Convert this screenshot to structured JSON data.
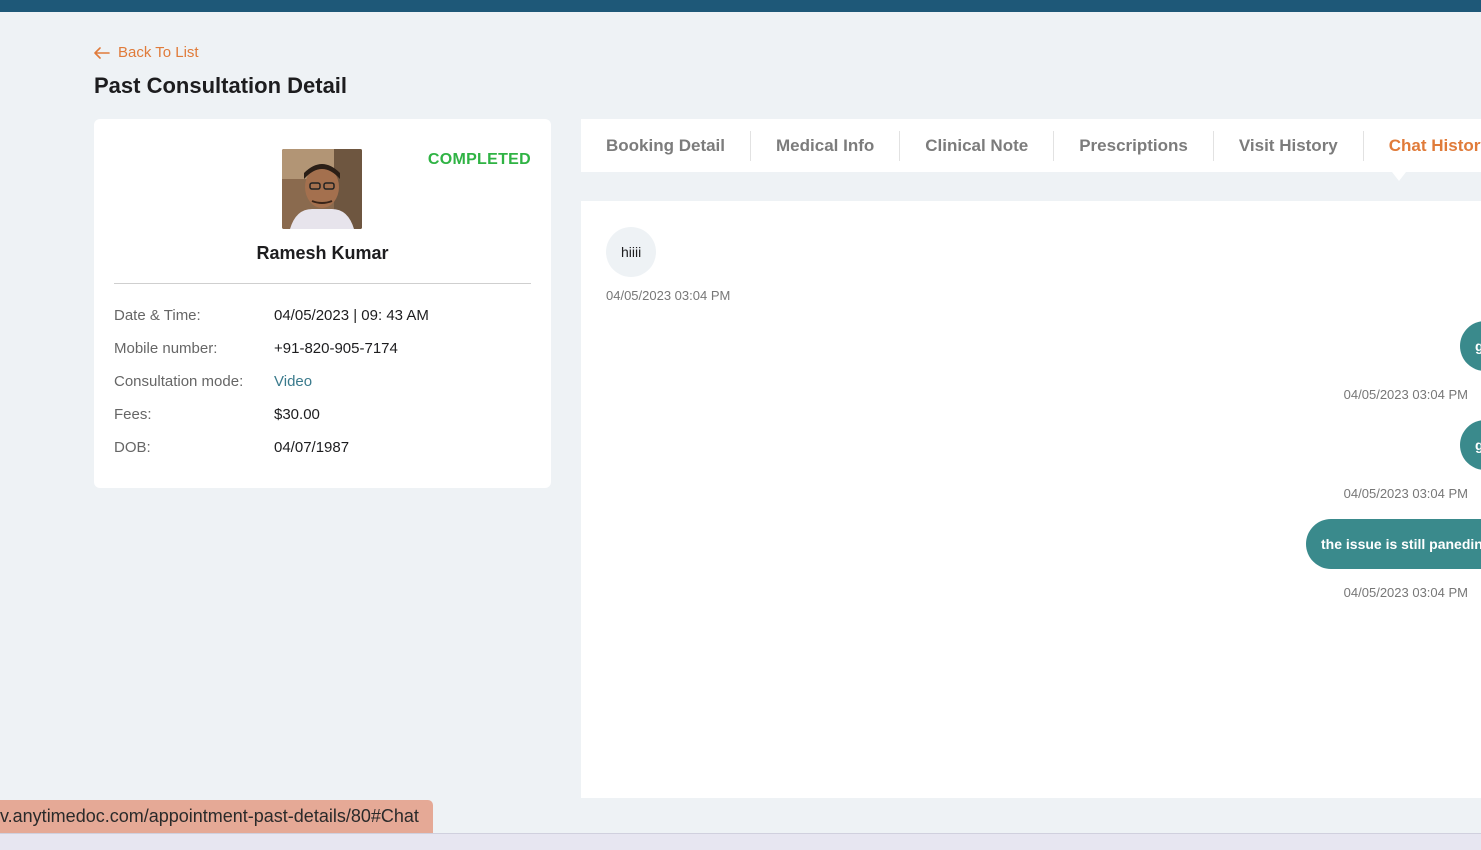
{
  "back_label": "Back To List",
  "page_title": "Past Consultation Detail",
  "patient": {
    "status": "COMPLETED",
    "name": "Ramesh Kumar",
    "details": [
      {
        "label": "Date & Time:",
        "value": "04/05/2023 | 09: 43 AM"
      },
      {
        "label": "Mobile number:",
        "value": "+91-820-905-7174"
      },
      {
        "label": "Consultation mode:",
        "value": "Video"
      },
      {
        "label": "Fees:",
        "value": "$30.00"
      },
      {
        "label": "DOB:",
        "value": "04/07/1987"
      }
    ]
  },
  "tabs": [
    "Booking Detail",
    "Medical Info",
    "Clinical Note",
    "Prescriptions",
    "Visit History",
    "Chat History"
  ],
  "active_tab": "Chat History",
  "messages": [
    {
      "direction": "incoming",
      "text": "hiiii",
      "time": "04/05/2023 03:04 PM"
    },
    {
      "direction": "outgoing",
      "text": "g",
      "time": "04/05/2023 03:04 PM"
    },
    {
      "direction": "outgoing",
      "text": "g",
      "time": "04/05/2023 03:04 PM"
    },
    {
      "direction": "outgoing",
      "text": "the issue is still paneding",
      "time": "04/05/2023 03:04 PM"
    }
  ],
  "status_url": "v.anytimedoc.com/appointment-past-details/80#Chat",
  "colors": {
    "accent": "#e07b3a",
    "status": "#2fb344",
    "bubble_out": "#3a8a8c",
    "topbar": "#1e5878"
  }
}
